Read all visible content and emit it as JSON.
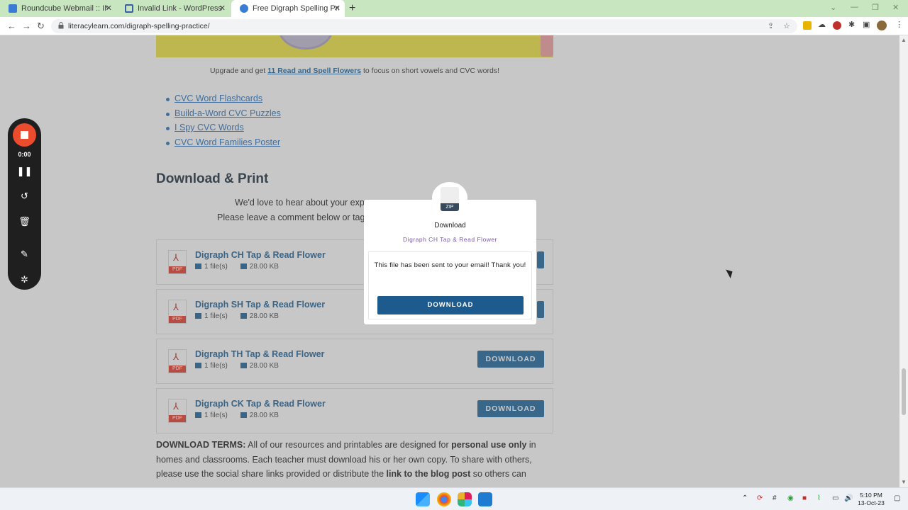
{
  "browser": {
    "tabs": [
      {
        "title": "Roundcube Webmail :: INBOX",
        "active": false
      },
      {
        "title": "Invalid Link - WordPress Downlo",
        "active": false
      },
      {
        "title": "Free Digraph Spelling Practice A",
        "active": true
      }
    ],
    "new_tab": "+",
    "url": "literacylearn.com/digraph-spelling-practice/"
  },
  "page": {
    "upsell": {
      "before": "Upgrade and get ",
      "link": "11 Read and Spell Flowers",
      "after": " to focus on short vowels and CVC words!"
    },
    "links": [
      "CVC Word Flashcards",
      "Build-a-Word CVC Puzzles",
      "I Spy CVC Words",
      "CVC Word Families Poster"
    ],
    "heading": "Download & Print",
    "intro_line1": "We'd love to hear about your exp",
    "intro_line2": "Please leave a comment below or tag",
    "downloads": [
      {
        "name": "Digraph CH Tap & Read Flower",
        "files": "1 file(s)",
        "size": "28.00 KB",
        "button": ""
      },
      {
        "name": "Digraph SH Tap & Read Flower",
        "files": "1 file(s)",
        "size": "28.00 KB",
        "button": ""
      },
      {
        "name": "Digraph TH Tap & Read Flower",
        "files": "1 file(s)",
        "size": "28.00 KB",
        "button": "DOWNLOAD"
      },
      {
        "name": "Digraph CK Tap & Read Flower",
        "files": "1 file(s)",
        "size": "28.00 KB",
        "button": "DOWNLOAD"
      }
    ],
    "pdf_label": "PDF",
    "terms": {
      "label": "DOWNLOAD TERMS:",
      "t1": " All of our resources and printables are designed for ",
      "b1": "personal use only",
      "t2": " in homes and classrooms. Each teacher must download his or her own copy. To share with others, please use the social share links provided or distribute the ",
      "b2": "link to the blog post",
      "t3": " so others can"
    }
  },
  "modal": {
    "zip_label": "ZIP",
    "title": "Download",
    "subtitle": "Digraph CH Tap & Read Flower",
    "message": "This file has been sent to your email! Thank you!",
    "button": "DOWNLOAD"
  },
  "recorder": {
    "time": "0:00"
  },
  "taskbar": {
    "time": "5:10 PM",
    "date": "13-Oct-23"
  },
  "colors": {
    "link": "#2e6fa3",
    "button": "#2f72a6",
    "modal_button": "#1d5a8e",
    "record": "#ea4c2d"
  }
}
